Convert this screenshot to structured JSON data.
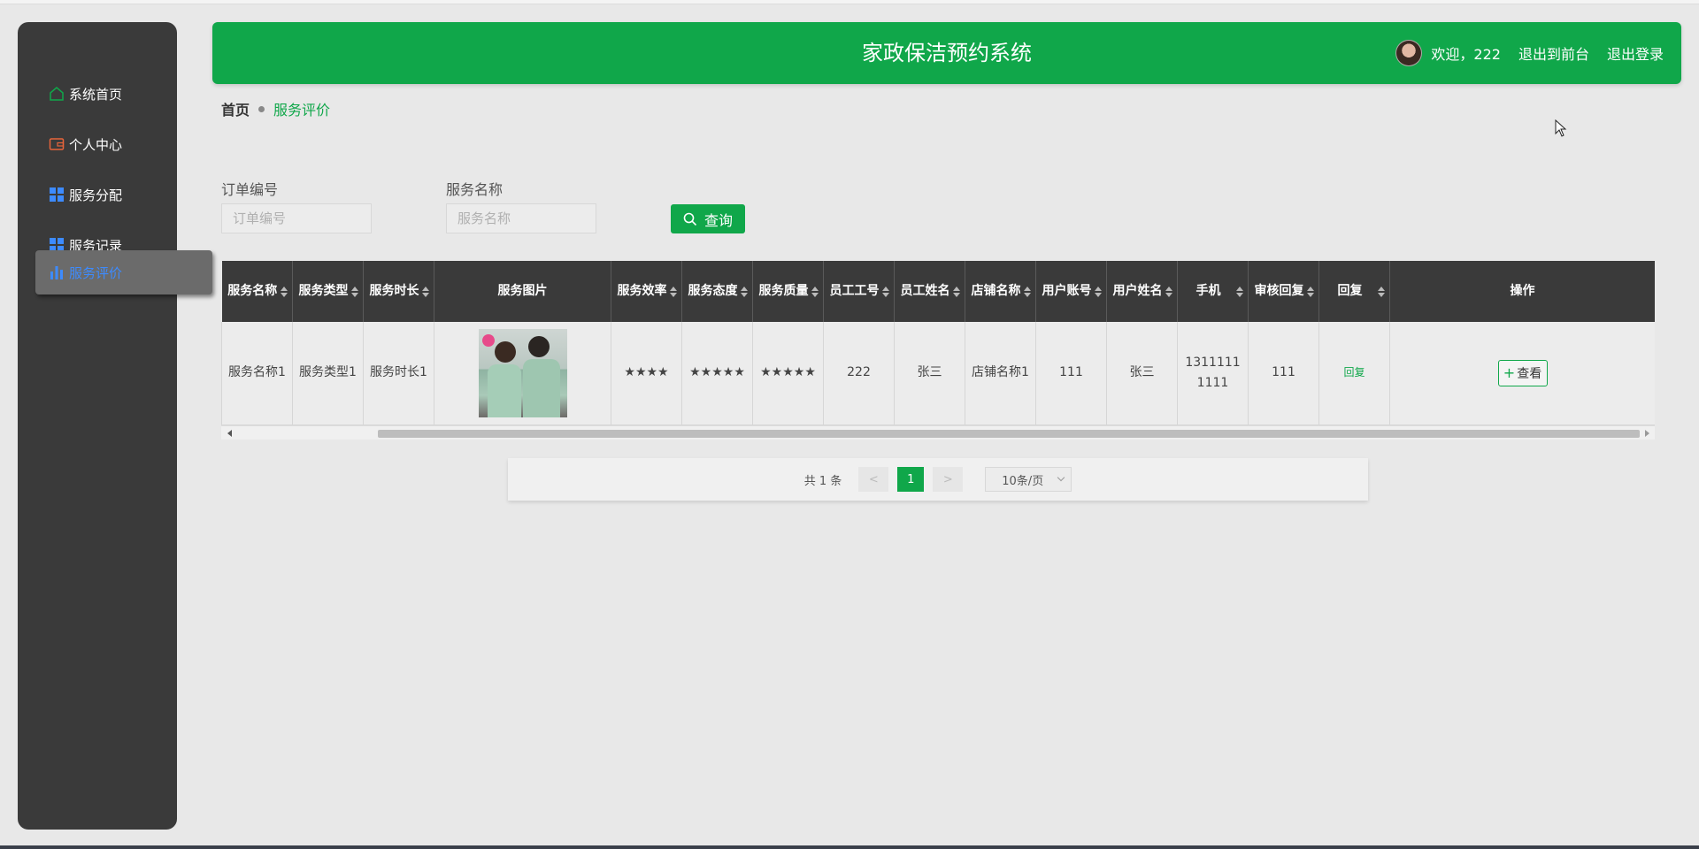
{
  "app": {
    "title": "家政保洁预约系统"
  },
  "header": {
    "welcome": "欢迎，222",
    "to_front": "退出到前台",
    "logout": "退出登录"
  },
  "sidebar": {
    "items": [
      {
        "label": "系统首页",
        "icon": "home-icon"
      },
      {
        "label": "个人中心",
        "icon": "wallet-icon"
      },
      {
        "label": "服务分配",
        "icon": "grid-icon"
      },
      {
        "label": "服务记录",
        "icon": "grid-icon"
      },
      {
        "label": "服务评价",
        "icon": "bar-chart-icon",
        "active": true
      }
    ]
  },
  "breadcrumb": {
    "home": "首页",
    "current": "服务评价"
  },
  "search": {
    "order_label": "订单编号",
    "order_placeholder": "订单编号",
    "service_label": "服务名称",
    "service_placeholder": "服务名称",
    "button": "查询"
  },
  "table": {
    "headers": [
      "服务名称",
      "服务类型",
      "服务时长",
      "服务图片",
      "服务效率",
      "服务态度",
      "服务质量",
      "员工工号",
      "员工姓名",
      "店铺名称",
      "用户账号",
      "用户姓名",
      "手机",
      "审核回复",
      "回复",
      "操作"
    ],
    "rows": [
      {
        "service_name": "服务名称1",
        "service_type": "服务类型1",
        "duration": "服务时长1",
        "efficiency": "★★★★",
        "attitude": "★★★★★",
        "quality": "★★★★★",
        "staff_no": "222",
        "staff_name": "张三",
        "shop_name": "店铺名称1",
        "user_account": "111",
        "user_name": "张三",
        "phone": "13111111111",
        "review_reply": "111",
        "reply": "回复",
        "action": "查看"
      }
    ]
  },
  "pagination": {
    "total": "共 1 条",
    "prev": "<",
    "page": "1",
    "next": ">",
    "page_size": "10条/页"
  },
  "colors": {
    "primary": "#10a74a",
    "sidebar": "#3a3a3a",
    "active_text": "#3d8bff"
  }
}
